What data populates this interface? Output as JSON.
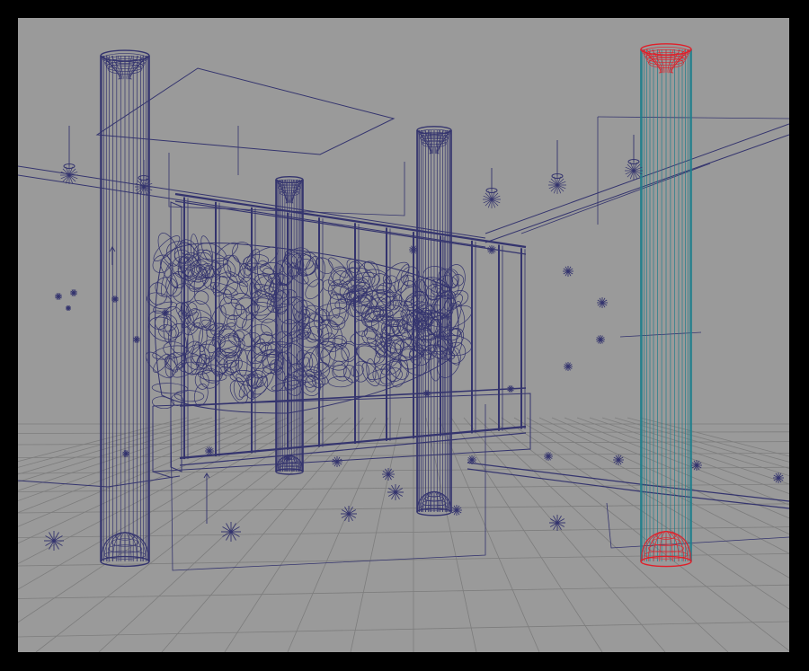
{
  "viewport": {
    "label": "perspective-wireframe-viewport",
    "colors": {
      "background": "#9a9a9a",
      "frame": "#000000",
      "grid": "#7d7d7d",
      "wireframe": "#34346e",
      "selected_body": "#1f7f8c",
      "selected_caps": "#e0202a"
    }
  },
  "scene": {
    "objects": [
      {
        "name": "column-left",
        "color_key": "wireframe"
      },
      {
        "name": "column-center-back",
        "color_key": "wireframe"
      },
      {
        "name": "column-center-front",
        "color_key": "wireframe"
      },
      {
        "name": "column-selected",
        "color_key": "selected_body"
      },
      {
        "name": "window-frame",
        "color_key": "wireframe"
      },
      {
        "name": "foliage-mesh",
        "color_key": "wireframe"
      },
      {
        "name": "ceiling-panel",
        "color_key": "wireframe"
      },
      {
        "name": "light-sources",
        "color_key": "wireframe"
      },
      {
        "name": "ground-grid",
        "color_key": "grid"
      }
    ]
  }
}
